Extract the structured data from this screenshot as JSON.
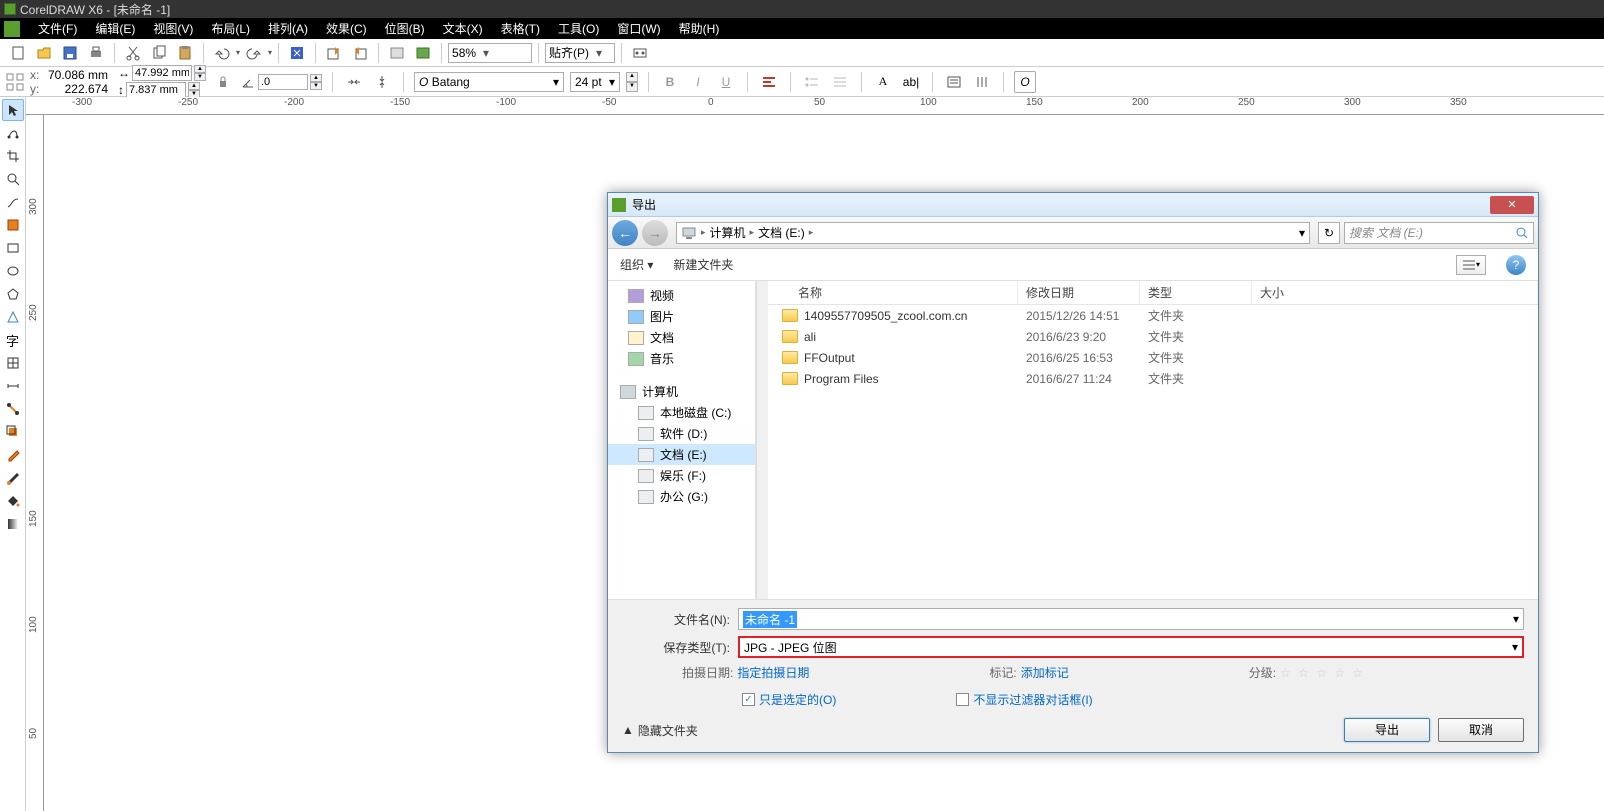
{
  "app": {
    "title": "CorelDRAW X6 - [未命名 -1]"
  },
  "menu": [
    "文件(F)",
    "编辑(E)",
    "视图(V)",
    "布局(L)",
    "排列(A)",
    "效果(C)",
    "位图(B)",
    "文本(X)",
    "表格(T)",
    "工具(O)",
    "窗口(W)",
    "帮助(H)"
  ],
  "toolbar1": {
    "zoom": "58%",
    "snap": "贴齐(P)"
  },
  "propbar": {
    "x": "70.086 mm",
    "y": "222.674 mm",
    "w": "47.992 mm",
    "h": "7.837 mm",
    "angle": ".0",
    "font": "Batang",
    "font_prefix": "O",
    "size": "24 pt"
  },
  "ruler_h": [
    -300,
    -250,
    -200,
    -150,
    -100,
    -50,
    0,
    50,
    100,
    150,
    200,
    250,
    300,
    350
  ],
  "ruler_v": [
    300,
    250,
    150,
    100,
    50
  ],
  "dialog": {
    "title": "导出",
    "breadcrumb": [
      "计算机",
      "文档 (E:)"
    ],
    "search_placeholder": "搜索 文档 (E:)",
    "toolbar": {
      "organize": "组织 ▾",
      "newfolder": "新建文件夹"
    },
    "tree": [
      {
        "label": "视频",
        "cls": "vid"
      },
      {
        "label": "图片",
        "cls": "img"
      },
      {
        "label": "文档",
        "cls": "doc"
      },
      {
        "label": "音乐",
        "cls": "mus"
      }
    ],
    "tree_pc": "计算机",
    "tree_drives": [
      {
        "label": "本地磁盘 (C:)"
      },
      {
        "label": "软件 (D:)"
      },
      {
        "label": "文档 (E:)",
        "sel": true
      },
      {
        "label": "娱乐 (F:)"
      },
      {
        "label": "办公 (G:)"
      }
    ],
    "cols": {
      "name": "名称",
      "date": "修改日期",
      "type": "类型",
      "size": "大小"
    },
    "files": [
      {
        "name": "1409557709505_zcool.com.cn",
        "date": "2015/12/26 14:51",
        "type": "文件夹"
      },
      {
        "name": "ali",
        "date": "2016/6/23 9:20",
        "type": "文件夹"
      },
      {
        "name": "FFOutput",
        "date": "2016/6/25 16:53",
        "type": "文件夹"
      },
      {
        "name": "Program Files",
        "date": "2016/6/27 11:24",
        "type": "文件夹"
      }
    ],
    "filename_lbl": "文件名(N):",
    "filename_val": "未命名 -1",
    "filetype_lbl": "保存类型(T):",
    "filetype_val": "JPG - JPEG 位图",
    "meta": {
      "shotdate_k": "拍摄日期:",
      "shotdate_v": "指定拍摄日期",
      "tag_k": "标记:",
      "tag_v": "添加标记",
      "rating_k": "分级:"
    },
    "opt_selected": "只是选定的(O)",
    "opt_nofilter": "不显示过滤器对话框(I)",
    "hide": "隐藏文件夹",
    "export_btn": "导出",
    "cancel_btn": "取消"
  }
}
